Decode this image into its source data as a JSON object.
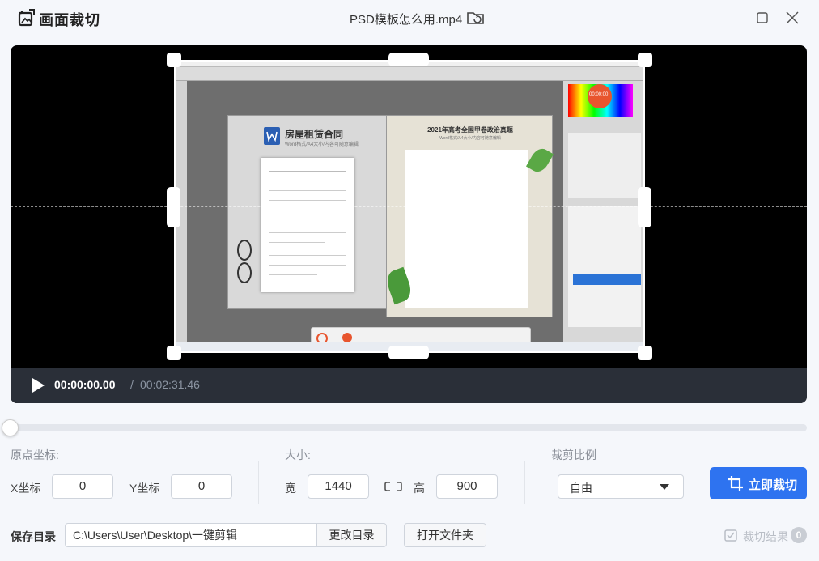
{
  "app": {
    "title": "画面裁切",
    "file_name": "PSD模板怎么用.mp4"
  },
  "player": {
    "current_time": "00:00:00.00",
    "separator": "/",
    "total_time": "00:02:31.46",
    "progress": 0,
    "preview": {
      "doc1_title": "房屋租赁合同",
      "doc1_subtitle": "Word格式/A4大小/内容可随意编辑",
      "doc2_title": "2021年高考全国甲卷政治真题",
      "doc2_subtitle": "Word格式/A4大小/内容可随意编辑",
      "badge_text": "00:00:00"
    }
  },
  "params": {
    "origin_label": "原点坐标:",
    "x_label": "X坐标",
    "x_value": "0",
    "y_label": "Y坐标",
    "y_value": "0",
    "size_label": "大小:",
    "width_label": "宽",
    "width_value": "1440",
    "height_label": "高",
    "height_value": "900",
    "ratio_label": "裁剪比例",
    "ratio_value": "自由",
    "crop_button": "立即裁切"
  },
  "save": {
    "label": "保存目录",
    "path": "C:\\Users\\User\\Desktop\\一键剪辑",
    "change_button": "更改目录",
    "open_button": "打开文件夹",
    "result_label": "裁切结果",
    "result_count": "0"
  },
  "colors": {
    "accent": "#2e73f0",
    "player_bg": "#000000",
    "controls_bg": "#2a2f38"
  }
}
